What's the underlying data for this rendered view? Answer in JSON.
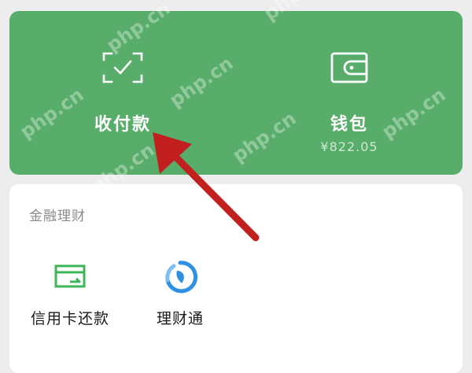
{
  "wallet_card": {
    "payment": {
      "label": "收付款",
      "icon": "scan-frame-check-icon"
    },
    "wallet": {
      "label": "钱包",
      "balance": "¥822.05",
      "icon": "wallet-icon"
    }
  },
  "finance": {
    "title": "金融理财",
    "items": [
      {
        "label": "信用卡还款",
        "icon": "credit-card-icon"
      },
      {
        "label": "理财通",
        "icon": "licaitong-icon"
      }
    ]
  },
  "annotation": {
    "color": "#c21f1f"
  },
  "watermark": {
    "text": "php.cn"
  },
  "colors": {
    "background": "#ededed",
    "card_green": "#57ad69",
    "credit_icon_green": "#3fb55a",
    "licaitong_blue": "#2f8fe0"
  }
}
